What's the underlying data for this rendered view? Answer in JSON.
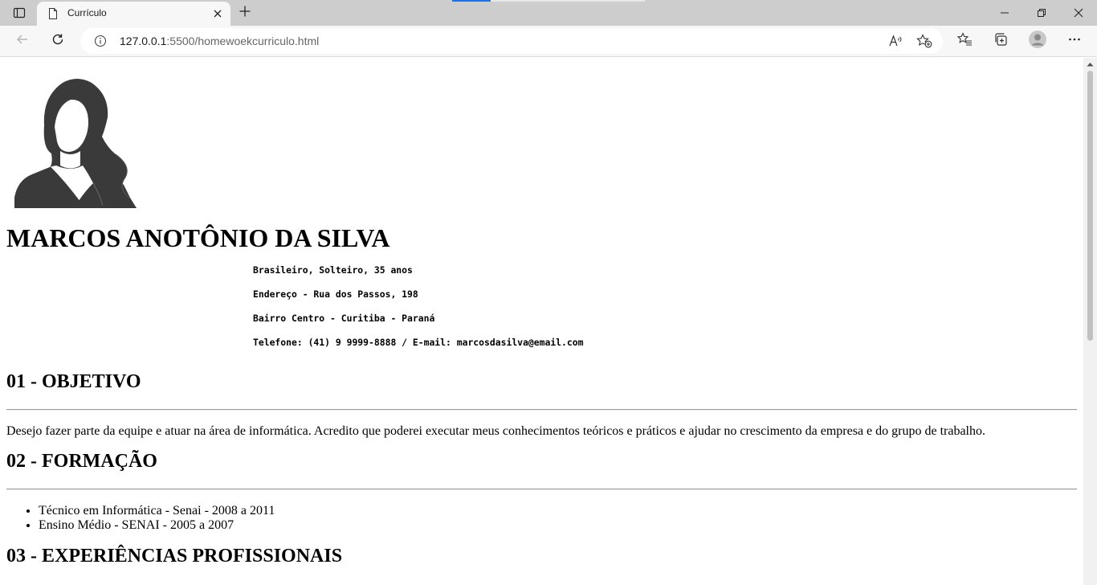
{
  "browser": {
    "tab_title": "Currículo",
    "url_host": "127.0.0.1",
    "url_rest": ":5500/homewoekcurriculo.html",
    "icons": {
      "tab_actions": "tab-actions-icon",
      "favicon": "document-icon",
      "tab_close": "close-icon",
      "new_tab": "plus-icon",
      "minimize": "minimize-icon",
      "restore": "restore-icon",
      "window_close": "close-icon",
      "back": "back-arrow-icon",
      "refresh": "refresh-icon",
      "site_info": "info-icon",
      "read_aloud": "read-aloud-icon",
      "add_favorite": "add-favorite-icon",
      "favorites": "favorites-icon",
      "collections": "collections-icon",
      "profile": "profile-icon",
      "menu": "more-icon"
    }
  },
  "resume": {
    "name": "MARCOS ANOTÔNIO DA SILVA",
    "personal": [
      "Brasileiro, Solteiro, 35 anos",
      "Endereço - Rua dos Passos, 198",
      "Bairro Centro - Curitiba - Paraná",
      "Telefone: (41) 9 9999-8888 / E-mail: marcosdasilva@email.com"
    ],
    "sections": {
      "objetivo_title": "01 - OBJETIVO",
      "objetivo_text": "Desejo fazer parte da equipe e atuar na área de informática. Acredito que poderei executar meus conhecimentos teóricos e práticos e ajudar no crescimento da empresa e do grupo de trabalho.",
      "formacao_title": "02 - FORMAÇÃO",
      "formacao_items": [
        "Técnico em Informática - Senai - 2008 a 2011",
        "Ensino Médio - SENAI - 2005 a 2007"
      ],
      "experiencias_title": "03 - EXPERIÊNCIAS PROFISSIONAIS"
    }
  },
  "colors": {
    "titlebar": "#cdcdcd",
    "toolbar": "#f7f7f7",
    "avatar": "#3a3a3a"
  }
}
